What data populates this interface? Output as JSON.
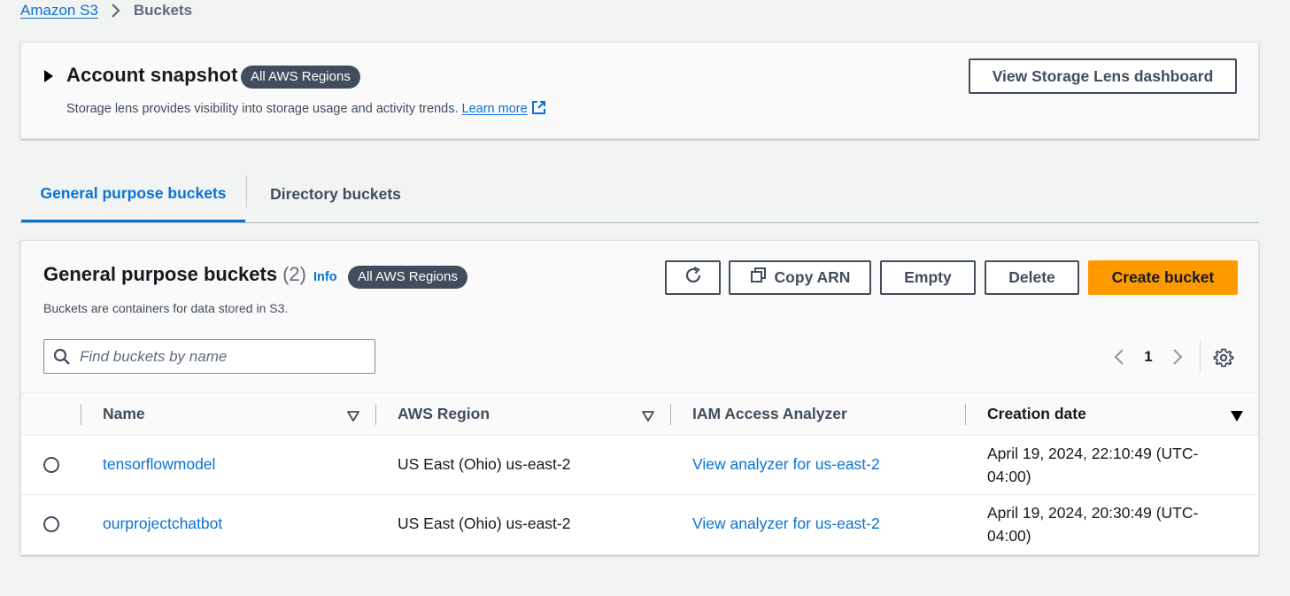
{
  "breadcrumb": {
    "root": "Amazon S3",
    "current": "Buckets"
  },
  "snapshot": {
    "title": "Account snapshot",
    "badge": "All AWS Regions",
    "description": "Storage lens provides visibility into storage usage and activity trends.",
    "learn_more": "Learn more",
    "button": "View Storage Lens dashboard"
  },
  "tabs": [
    {
      "label": "General purpose buckets",
      "active": true
    },
    {
      "label": "Directory buckets",
      "active": false
    }
  ],
  "buckets": {
    "title": "General purpose buckets",
    "count": "(2)",
    "info": "Info",
    "badge": "All AWS Regions",
    "description": "Buckets are containers for data stored in S3.",
    "actions": {
      "copy_arn": "Copy ARN",
      "empty": "Empty",
      "delete": "Delete",
      "create": "Create bucket"
    },
    "search_placeholder": "Find buckets by name",
    "page": "1",
    "columns": {
      "name": "Name",
      "region": "AWS Region",
      "analyzer": "IAM Access Analyzer",
      "created": "Creation date"
    },
    "rows": [
      {
        "name": "tensorflowmodel",
        "region": "US East (Ohio) us-east-2",
        "analyzer": "View analyzer for us-east-2",
        "created": "April 19, 2024, 22:10:49 (UTC-04:00)"
      },
      {
        "name": "ourprojectchatbot",
        "region": "US East (Ohio) us-east-2",
        "analyzer": "View analyzer for us-east-2",
        "created": "April 19, 2024, 20:30:49 (UTC-04:00)"
      }
    ]
  },
  "colors": {
    "link": "#0972d3",
    "primary": "#ff9900",
    "badge": "#414d5c"
  }
}
